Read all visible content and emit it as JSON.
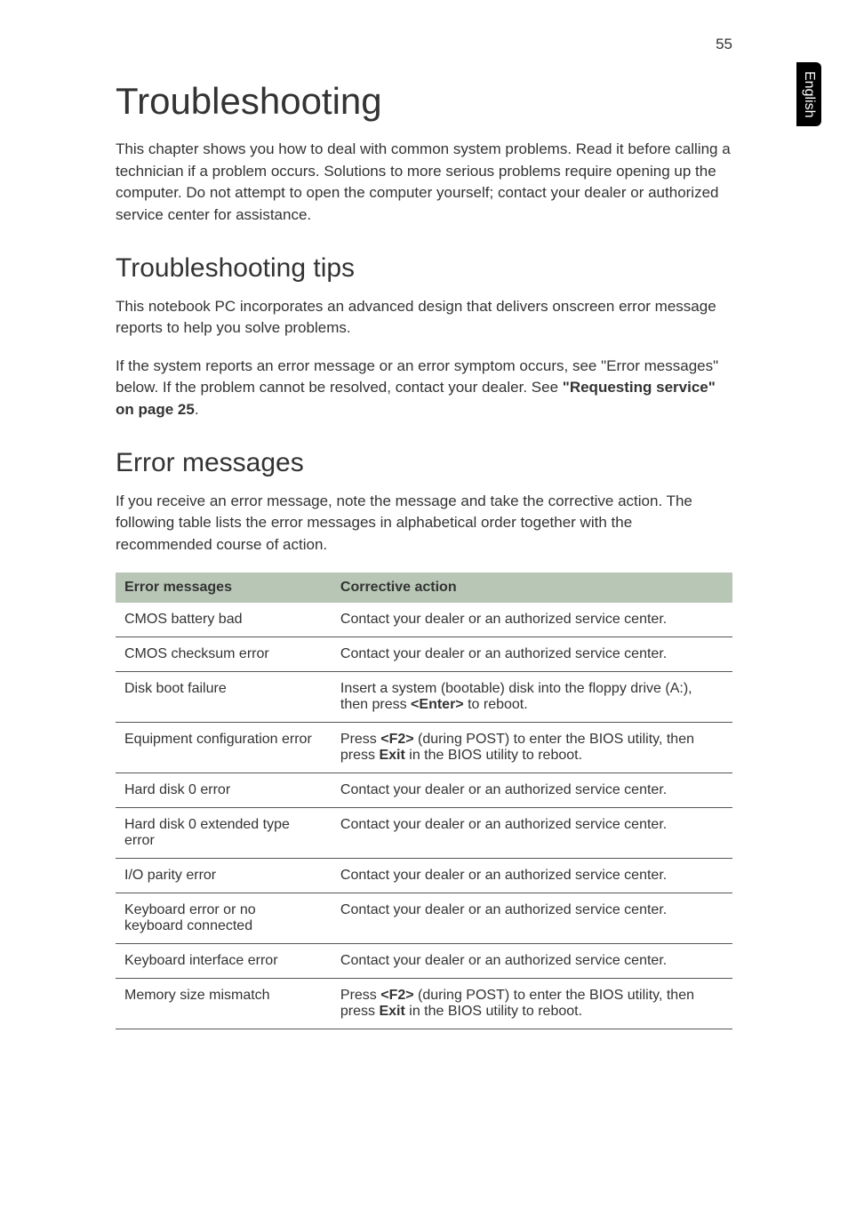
{
  "page_number": "55",
  "side_tab": "English",
  "h1": "Troubleshooting",
  "intro": "This chapter shows you how to deal with common system problems. Read it before calling a technician if a problem occurs. Solutions to more serious problems require opening up the computer. Do not attempt to open the computer yourself; contact your dealer or authorized service center for assistance.",
  "tips_heading": "Troubleshooting tips",
  "tips_p1": "This notebook PC incorporates an advanced design that delivers onscreen error message reports to help you solve problems.",
  "tips_p2a": "If the system reports an error message or an error symptom occurs, see \"Error messages\" below. If the problem cannot be resolved, contact your dealer. See ",
  "tips_p2b": "\"Requesting service\" on page 25",
  "tips_p2c": ".",
  "errors_heading": "Error messages",
  "errors_intro": "If you receive an error message, note the message and take the corrective action. The following table lists the error messages in alphabetical order together with the recommended course of action.",
  "table": {
    "col1": "Error messages",
    "col2": "Corrective action",
    "rows": [
      {
        "msg": "CMOS battery bad",
        "action_parts": [
          {
            "text": "Contact your dealer or an authorized service center.",
            "bold": false
          }
        ]
      },
      {
        "msg": "CMOS checksum error",
        "action_parts": [
          {
            "text": "Contact your dealer or an authorized service center.",
            "bold": false
          }
        ]
      },
      {
        "msg": "Disk boot failure",
        "action_parts": [
          {
            "text": "Insert a system (bootable) disk into the floppy drive (A:), then press ",
            "bold": false
          },
          {
            "text": "<Enter>",
            "bold": true
          },
          {
            "text": " to reboot.",
            "bold": false
          }
        ]
      },
      {
        "msg": "Equipment configuration error",
        "action_parts": [
          {
            "text": "Press ",
            "bold": false
          },
          {
            "text": "<F2>",
            "bold": true
          },
          {
            "text": " (during POST) to enter the BIOS utility, then press ",
            "bold": false
          },
          {
            "text": "Exit",
            "bold": true
          },
          {
            "text": " in the BIOS utility to reboot.",
            "bold": false
          }
        ]
      },
      {
        "msg": "Hard disk 0 error",
        "action_parts": [
          {
            "text": "Contact your dealer or an authorized service center.",
            "bold": false
          }
        ]
      },
      {
        "msg": "Hard disk 0 extended type error",
        "action_parts": [
          {
            "text": "Contact your dealer or an authorized service center.",
            "bold": false
          }
        ]
      },
      {
        "msg": "I/O parity error",
        "action_parts": [
          {
            "text": "Contact your dealer or an authorized service center.",
            "bold": false
          }
        ]
      },
      {
        "msg": "Keyboard error or no keyboard connected",
        "action_parts": [
          {
            "text": "Contact your dealer or an authorized service center.",
            "bold": false
          }
        ]
      },
      {
        "msg": "Keyboard interface error",
        "action_parts": [
          {
            "text": "Contact your dealer or an authorized service center.",
            "bold": false
          }
        ]
      },
      {
        "msg": "Memory size mismatch",
        "action_parts": [
          {
            "text": "Press ",
            "bold": false
          },
          {
            "text": "<F2>",
            "bold": true
          },
          {
            "text": " (during POST) to enter the BIOS utility, then press ",
            "bold": false
          },
          {
            "text": "Exit",
            "bold": true
          },
          {
            "text": " in the BIOS utility to reboot.",
            "bold": false
          }
        ]
      }
    ]
  }
}
